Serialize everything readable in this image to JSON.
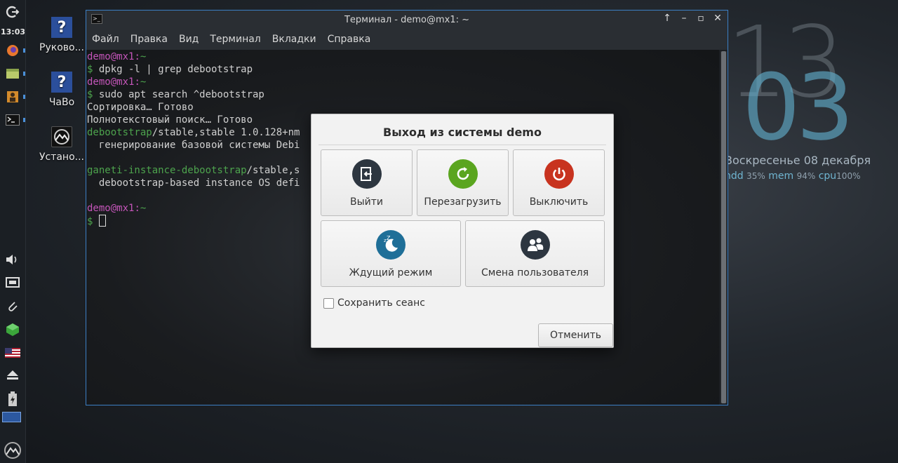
{
  "panel": {
    "time": "13:03"
  },
  "desktop": {
    "icons": [
      {
        "label": "Руково..."
      },
      {
        "label": "ЧаВо"
      },
      {
        "label": "Устано..."
      }
    ]
  },
  "conky": {
    "hour": "13",
    "minute": "03",
    "date": "Воскресенье  08 декабря",
    "hdd_label": "hdd",
    "hdd_value": "35%",
    "mem_label": "mem",
    "mem_value": "94%",
    "cpu_label": "cpu",
    "cpu_value": "100%"
  },
  "terminal": {
    "title": "Терминал - demo@mx1: ~",
    "menu": [
      "Файл",
      "Правка",
      "Вид",
      "Терминал",
      "Вкладки",
      "Справка"
    ],
    "user": "demo",
    "host": "mx1",
    "cwd": "~",
    "cmd1": "dpkg -l | grep debootstrap",
    "cmd2": "sudo apt search ^debootstrap",
    "out1": "Сортировка… Готово",
    "out2": "Полнотекстовый поиск… Готово",
    "pkg1_name": "debootstrap",
    "pkg1_rest": "/stable,stable 1.0.128+nm",
    "pkg1_desc": "  генерирование базовой системы Debi",
    "pkg2_name": "ganeti-instance-debootstrap",
    "pkg2_rest": "/stable,s",
    "pkg2_desc": "  debootstrap-based instance OS defi"
  },
  "dialog": {
    "title": "Выход из системы demo",
    "logout": "Выйти",
    "restart": "Перезагрузить",
    "shutdown": "Выключить",
    "suspend": "Ждущий режим",
    "switch_user": "Смена пользователя",
    "save_session": "Сохранить сеанс",
    "cancel": "Отменить",
    "colors": {
      "logout": "#2d3640",
      "restart": "#5aa51f",
      "shutdown": "#c8331f",
      "suspend": "#1f6f98",
      "switch_user": "#2d3640"
    }
  }
}
